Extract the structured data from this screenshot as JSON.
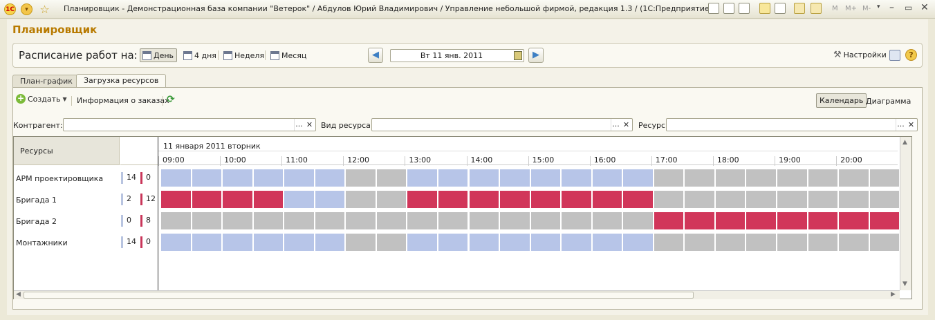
{
  "window": {
    "title": "Планировщик - Демонстрационная база компании \"Ветерок\" / Абдулов Юрий Владимирович / Управление небольшой фирмой, редакция 1.3 / (1С:Предприятие)",
    "logo_text": "1С",
    "toolbar_texts": [
      "M",
      "M+",
      "M-"
    ]
  },
  "app": {
    "title": "Планировщик"
  },
  "schedule": {
    "label": "Расписание работ на:",
    "views": [
      {
        "label": "День",
        "active": true
      },
      {
        "label": "4 дня",
        "active": false
      },
      {
        "label": "Неделя",
        "active": false
      },
      {
        "label": "Месяц",
        "active": false
      }
    ],
    "date": "Вт 11 янв. 2011",
    "settings_label": "Настройки"
  },
  "tabs": [
    {
      "label": "План-график",
      "active": false
    },
    {
      "label": "Загрузка ресурсов",
      "active": true
    }
  ],
  "command_bar": {
    "create_label": "Создать",
    "orders_info_label": "Информация о заказах",
    "calendar_label": "Календарь",
    "diagram_label": "Диаграмма"
  },
  "filters": {
    "counterparty_label": "Контрагент:",
    "resource_type_label": "Вид ресурса:",
    "resource_label": "Ресурс:",
    "dots": "...",
    "clear": "✕"
  },
  "grid": {
    "resources_header": "Ресурсы",
    "date_header": "11 января 2011 вторник",
    "hours": [
      "09:00",
      "10:00",
      "11:00",
      "12:00",
      "13:00",
      "14:00",
      "15:00",
      "16:00",
      "17:00",
      "18:00",
      "19:00",
      "20:00"
    ],
    "rows": [
      {
        "name": "АРМ проектировщика",
        "free": "14",
        "busy": "0",
        "cells": [
          "free",
          "free",
          "free",
          "free",
          "free",
          "free",
          "off",
          "off",
          "free",
          "free",
          "free",
          "free",
          "free",
          "free",
          "free",
          "free",
          "off",
          "off",
          "off",
          "off",
          "off",
          "off",
          "off",
          "off"
        ]
      },
      {
        "name": "Бригада 1",
        "free": "2",
        "busy": "12",
        "cells": [
          "busy",
          "busy",
          "busy",
          "busy",
          "free",
          "free",
          "off",
          "off",
          "busy",
          "busy",
          "busy",
          "busy",
          "busy",
          "busy",
          "busy",
          "busy",
          "off",
          "off",
          "off",
          "off",
          "off",
          "off",
          "off",
          "off"
        ]
      },
      {
        "name": "Бригада 2",
        "free": "0",
        "busy": "8",
        "cells": [
          "off",
          "off",
          "off",
          "off",
          "off",
          "off",
          "off",
          "off",
          "off",
          "off",
          "off",
          "off",
          "off",
          "off",
          "off",
          "off",
          "busy",
          "busy",
          "busy",
          "busy",
          "busy",
          "busy",
          "busy",
          "busy"
        ]
      },
      {
        "name": "Монтажники",
        "free": "14",
        "busy": "0",
        "cells": [
          "free",
          "free",
          "free",
          "free",
          "free",
          "free",
          "off",
          "off",
          "free",
          "free",
          "free",
          "free",
          "free",
          "free",
          "free",
          "free",
          "off",
          "off",
          "off",
          "off",
          "off",
          "off",
          "off",
          "off"
        ]
      }
    ]
  },
  "colors": {
    "free": "#b7c5e8",
    "busy": "#d1365a",
    "off": "#c1c1c1",
    "title": "#b87a00"
  }
}
